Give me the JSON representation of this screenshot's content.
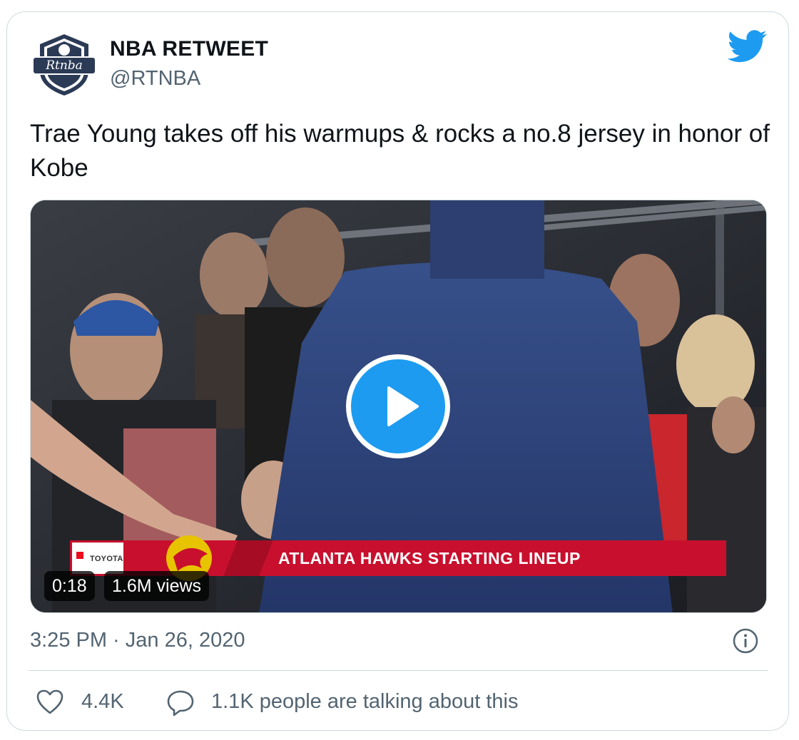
{
  "author": {
    "name": "NBA RETWEET",
    "handle": "@RTNBA",
    "avatar_text": "Rtnba"
  },
  "tweet": {
    "text": "Trae Young takes off his warmups & rocks a no.8 jersey in honor of Kobe"
  },
  "video": {
    "duration": "0:18",
    "views": "1.6M views",
    "lower_third": "ATLANTA HAWKS STARTING LINEUP",
    "sponsor": "TOYOTA"
  },
  "meta": {
    "timestamp": "3:25 PM · Jan 26, 2020"
  },
  "actions": {
    "likes": "4.4K",
    "replies": "1.1K people are talking about this"
  },
  "colors": {
    "twitter_blue": "#1d9bf0",
    "text": "#0f1419",
    "secondary": "#536471",
    "border": "#cfd9de",
    "hawks_red": "#c8102e"
  },
  "icons": [
    "twitter-bird-icon",
    "play-icon",
    "info-icon",
    "heart-icon",
    "speech-bubble-icon"
  ]
}
